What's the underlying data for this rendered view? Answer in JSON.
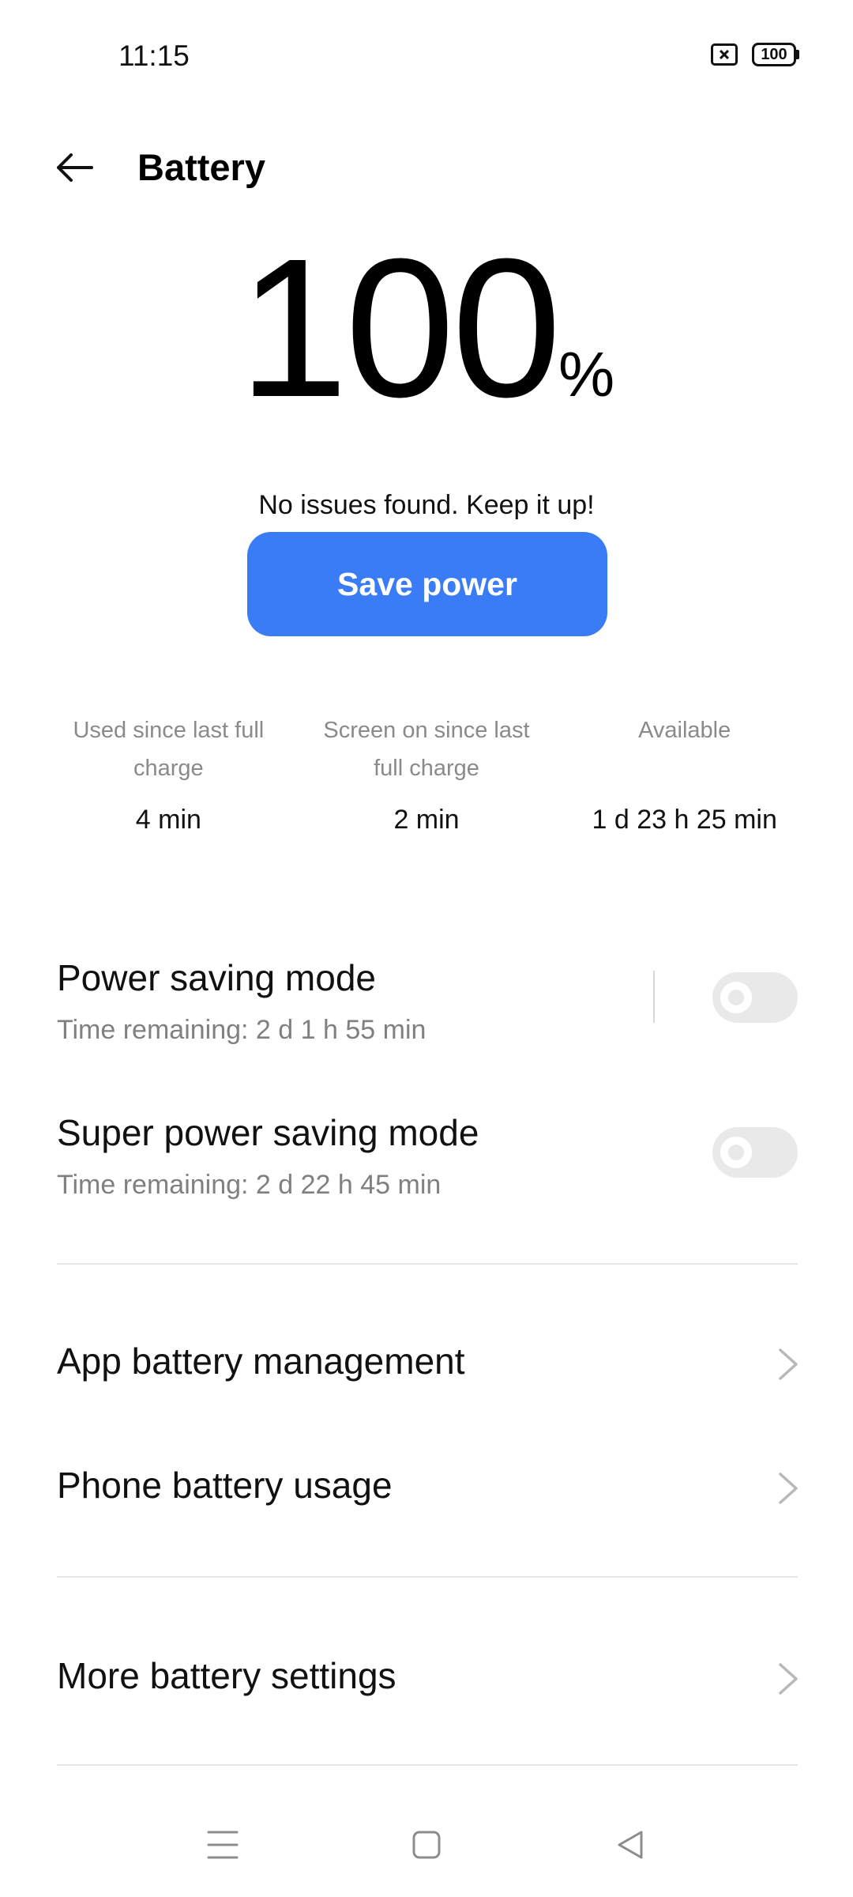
{
  "status_bar": {
    "time": "11:15",
    "battery_level": "100",
    "icons": [
      "sim-off-icon",
      "battery-icon"
    ]
  },
  "header": {
    "title": "Battery",
    "back_icon": "arrow-left-icon"
  },
  "battery": {
    "percent": "100",
    "unit": "%",
    "status_message": "No issues found. Keep it up!",
    "save_button_label": "Save power"
  },
  "stats": [
    {
      "label": "Used since last full charge",
      "value": "4 min"
    },
    {
      "label": "Screen on since last full charge",
      "value": "2 min"
    },
    {
      "label": "Available",
      "value": "1 d 23 h 25 min"
    }
  ],
  "modes": [
    {
      "title": "Power saving mode",
      "subtitle": "Time remaining:  2 d 1 h 55 min",
      "enabled": false
    },
    {
      "title": "Super power saving mode",
      "subtitle": "Time remaining:  2 d 22 h 45 min",
      "enabled": false
    }
  ],
  "menu": {
    "app_battery_management": "App battery management",
    "phone_battery_usage": "Phone battery usage",
    "more_battery_settings": "More battery settings"
  },
  "colors": {
    "accent": "#3a7cf6",
    "toggle_off": "#e9e9e9",
    "secondary_text": "#808080"
  },
  "system_nav": [
    "menu-icon",
    "home-icon",
    "back-triangle-icon"
  ]
}
